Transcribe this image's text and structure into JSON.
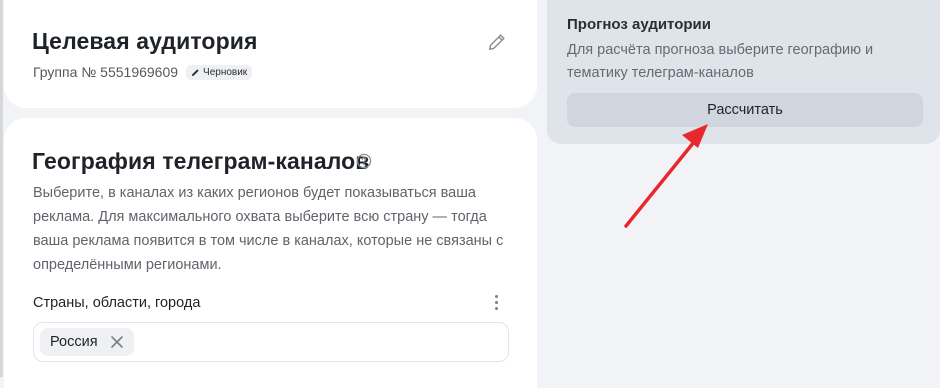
{
  "audience": {
    "title": "Целевая аудитория",
    "group": "Группа № 5551969609",
    "status_badge": "Черновик"
  },
  "geo": {
    "title": "География телеграм-каналов",
    "description": "Выберите, в каналах из каких регионов будет показываться ваша реклама. Для максимального охвата выберите всю страну — тогда ваша реклама появится в том числе в каналах, которые не связаны с определёнными регионами.",
    "field_label": "Страны, области, города",
    "selected_chip": "Россия"
  },
  "forecast": {
    "title": "Прогноз аудитории",
    "description": "Для расчёта прогноза выберите географию и тематику телеграм-каналов",
    "button_label": "Рассчитать"
  },
  "colors": {
    "annotation_arrow": "#e8282c",
    "forecast_panel": "#dfe3ea",
    "page_background": "#f1f3f6"
  },
  "icons": [
    "pencil-icon",
    "edit-badge-icon",
    "help-icon",
    "more-vertical-icon",
    "close-icon",
    "annotation-arrow"
  ]
}
